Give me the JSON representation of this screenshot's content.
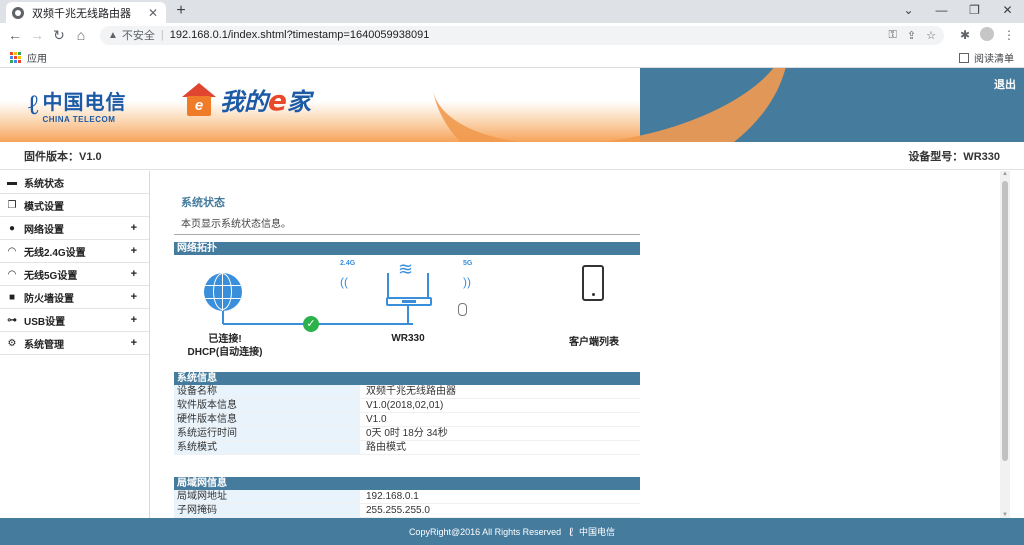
{
  "browser": {
    "tab_title": "双频千兆无线路由器",
    "tab_close": "✕",
    "new_tab": "+",
    "window_controls": [
      "⌄",
      "—",
      "❐",
      "✕"
    ],
    "nav": {
      "back": "←",
      "forward": "→",
      "reload": "↻",
      "home": "⌂"
    },
    "security_label": "不安全",
    "url": "192.168.0.1/index.shtml?timestamp=1640059938091",
    "bookmarks_label": "应用",
    "reading_list": "阅读清单"
  },
  "header": {
    "brand_cn": "中国电信",
    "brand_en": "CHINA TELECOM",
    "home_brand_prefix": "我的",
    "home_brand_e": "e",
    "home_brand_suffix": "家",
    "home_house_letter": "e",
    "logout": "退出"
  },
  "infobar": {
    "firmware": "固件版本：V1.0",
    "model": "设备型号：WR330"
  },
  "sidebar": {
    "items": [
      {
        "label": "系统状态",
        "icon": "chat-icon",
        "expandable": false
      },
      {
        "label": "模式设置",
        "icon": "window-icon",
        "expandable": false
      },
      {
        "label": "网络设置",
        "icon": "globe-icon",
        "expandable": true
      },
      {
        "label": "无线2.4G设置",
        "icon": "wifi-icon",
        "expandable": true
      },
      {
        "label": "无线5G设置",
        "icon": "wifi-icon",
        "expandable": true
      },
      {
        "label": "防火墙设置",
        "icon": "lock-icon",
        "expandable": true
      },
      {
        "label": "USB设置",
        "icon": "usb-icon",
        "expandable": true
      },
      {
        "label": "系统管理",
        "icon": "gear-icon",
        "expandable": true
      }
    ],
    "plus": "+"
  },
  "content": {
    "title": "系统状态",
    "description": "本页显示系统状态信息。",
    "topology": {
      "header": "网络拓扑",
      "status_line1": "已连接!",
      "status_line2": "DHCP(自动连接)",
      "router_name": "WR330",
      "band_24": "2.4G",
      "band_5": "5G",
      "client_list": "客户端列表",
      "check": "✓"
    },
    "system_info": {
      "header": "系统信息",
      "rows": [
        {
          "k": "设备名称",
          "v": "双频千兆无线路由器"
        },
        {
          "k": "软件版本信息",
          "v": "V1.0(2018,02,01)"
        },
        {
          "k": "硬件版本信息",
          "v": "V1.0"
        },
        {
          "k": "系统运行时间",
          "v": "0天 0时 18分 34秒"
        },
        {
          "k": "系统模式",
          "v": "路由模式"
        }
      ]
    },
    "lan_info": {
      "header": "局域网信息",
      "rows": [
        {
          "k": "局域网地址",
          "v": "192.168.0.1"
        },
        {
          "k": "子网掩码",
          "v": "255.255.255.0"
        }
      ]
    }
  },
  "footer": {
    "copyright": "CopyRight@2016 All Rights Reserved",
    "brand": "中国电信"
  },
  "colors": {
    "accent": "#457b9d",
    "topology_blue": "#3a8fdb",
    "ok_green": "#2cb24a"
  }
}
